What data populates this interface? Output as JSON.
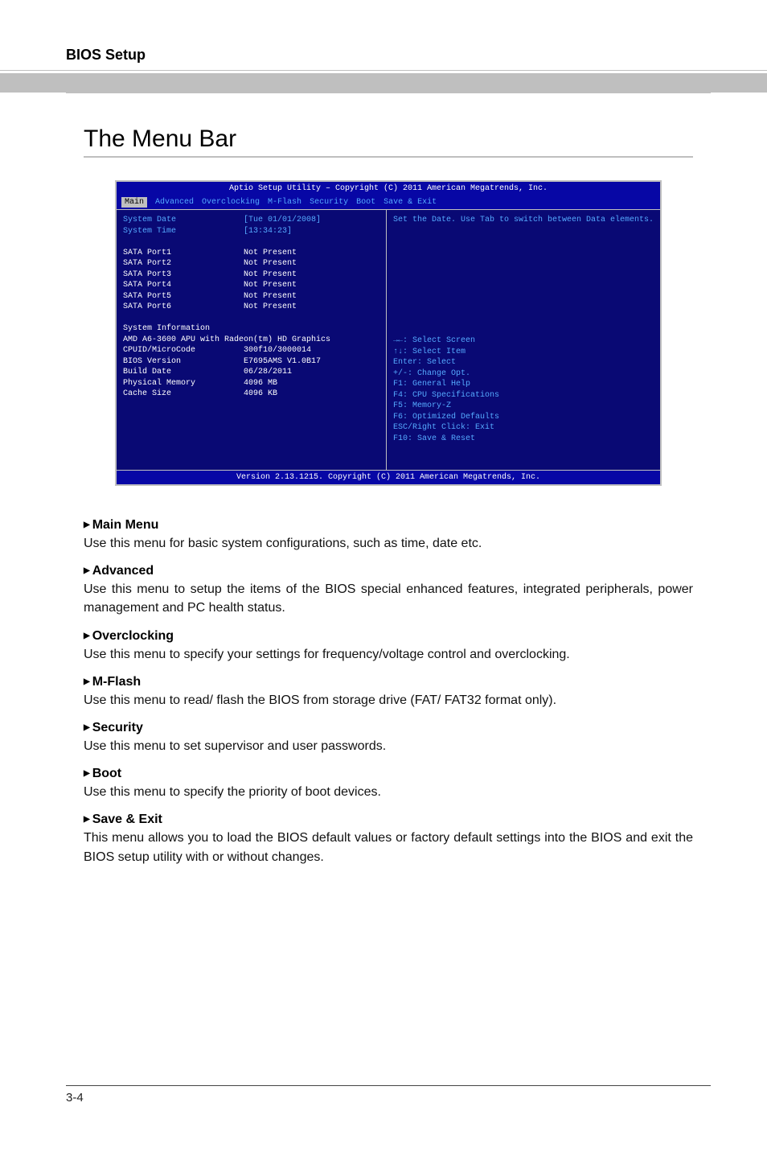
{
  "header": "BIOS Setup",
  "title": "The Menu Bar",
  "bios": {
    "titlebar": "Aptio Setup Utility – Copyright (C) 2011 American Megatrends, Inc.",
    "tabs": [
      "Main",
      "Advanced",
      "Overclocking",
      "M-Flash",
      "Security",
      "Boot",
      "Save & Exit"
    ],
    "active_tab_index": 0,
    "left_highlight": [
      {
        "label": "System Date",
        "value": "[Tue 01/01/2008]"
      },
      {
        "label": "System Time",
        "value": "[13:34:23]"
      }
    ],
    "sata_ports": [
      {
        "label": "SATA Port1",
        "value": "Not Present"
      },
      {
        "label": "SATA Port2",
        "value": "Not Present"
      },
      {
        "label": "SATA Port3",
        "value": "Not Present"
      },
      {
        "label": "SATA Port4",
        "value": "Not Present"
      },
      {
        "label": "SATA Port5",
        "value": "Not Present"
      },
      {
        "label": "SATA Port6",
        "value": "Not Present"
      }
    ],
    "sysinfo_header": "System Information",
    "sysinfo_cpu": "AMD A6-3600 APU with Radeon(tm) HD Graphics",
    "sysinfo_rows": [
      {
        "label": "CPUID/MicroCode",
        "value": "300f10/3000014"
      },
      {
        "label": "BIOS Version",
        "value": "E7695AMS V1.0B17"
      },
      {
        "label": "Build Date",
        "value": "06/28/2011"
      },
      {
        "label": "Physical Memory",
        "value": "4096 MB"
      },
      {
        "label": "Cache Size",
        "value": "4096 KB"
      }
    ],
    "help_top": "Set the Date. Use Tab to switch between Data elements.",
    "help_keys": [
      "→←: Select Screen",
      "↑↓: Select Item",
      "Enter: Select",
      "+/-: Change Opt.",
      "F1: General Help",
      "F4: CPU Specifications",
      "F5: Memory-Z",
      "F6: Optimized Defaults",
      "ESC/Right Click: Exit",
      "F10: Save & Reset"
    ],
    "footer": "Version 2.13.1215. Copyright (C) 2011 American Megatrends, Inc."
  },
  "menus": [
    {
      "title": "Main Menu",
      "desc": "Use this menu for basic system configurations, such as time, date etc."
    },
    {
      "title": "Advanced",
      "desc": "Use this menu to setup the items of the BIOS special enhanced features, integrated peripherals, power management and PC health status."
    },
    {
      "title": "Overclocking",
      "desc": "Use this menu to specify your settings for frequency/voltage control and overclocking."
    },
    {
      "title": "M-Flash",
      "desc": "Use this menu to read/ flash the BIOS from storage drive (FAT/ FAT32 format only)."
    },
    {
      "title": "Security",
      "desc": "Use this menu to set supervisor and user passwords."
    },
    {
      "title": "Boot",
      "desc": "Use this menu to specify the priority of boot devices."
    },
    {
      "title": "Save & Exit",
      "desc": "This menu allows you to load the BIOS default values or factory default settings into the BIOS and exit the BIOS setup utility with or without changes."
    }
  ],
  "page_number": "3-4"
}
